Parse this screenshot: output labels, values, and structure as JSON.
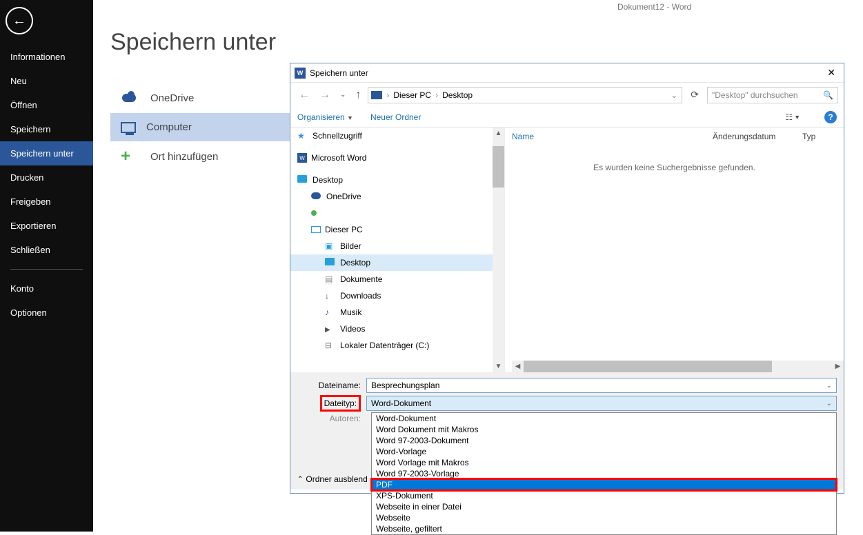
{
  "app_title": "Dokument12 - Word",
  "page_heading": "Speichern unter",
  "sidebar": {
    "items": [
      {
        "label": "Informationen"
      },
      {
        "label": "Neu"
      },
      {
        "label": "Öffnen"
      },
      {
        "label": "Speichern"
      },
      {
        "label": "Speichern unter",
        "selected": true
      },
      {
        "label": "Drucken"
      },
      {
        "label": "Freigeben"
      },
      {
        "label": "Exportieren"
      },
      {
        "label": "Schließen"
      }
    ],
    "account_label": "Konto",
    "options_label": "Optionen"
  },
  "locations": [
    {
      "label": "OneDrive",
      "icon": "cloud"
    },
    {
      "label": "Computer",
      "icon": "computer",
      "selected": true
    },
    {
      "label": "Ort hinzufügen",
      "icon": "plus"
    }
  ],
  "dialog": {
    "title": "Speichern unter",
    "breadcrumb": [
      "Dieser PC",
      "Desktop"
    ],
    "search_placeholder": "\"Desktop\" durchsuchen",
    "toolbar": {
      "organize": "Organisieren",
      "newfolder": "Neuer Ordner"
    },
    "tree": [
      {
        "label": "Schnellzugriff",
        "icon": "star",
        "lvl": 0
      },
      {
        "label": "Microsoft Word",
        "icon": "word",
        "lvl": 0
      },
      {
        "label": "Desktop",
        "icon": "folder-blue",
        "lvl": 0
      },
      {
        "label": "OneDrive",
        "icon": "cloud",
        "lvl": 1
      },
      {
        "label": "",
        "icon": "user",
        "lvl": 1
      },
      {
        "label": "Dieser PC",
        "icon": "pc",
        "lvl": 1
      },
      {
        "label": "Bilder",
        "icon": "folder-img",
        "lvl": 2
      },
      {
        "label": "Desktop",
        "icon": "folder-blue",
        "lvl": 2,
        "selected": true
      },
      {
        "label": "Dokumente",
        "icon": "folder-doc",
        "lvl": 2
      },
      {
        "label": "Downloads",
        "icon": "download",
        "lvl": 2
      },
      {
        "label": "Musik",
        "icon": "music",
        "lvl": 2
      },
      {
        "label": "Videos",
        "icon": "video",
        "lvl": 2
      },
      {
        "label": "Lokaler Datenträger (C:)",
        "icon": "disk",
        "lvl": 2
      }
    ],
    "columns": {
      "name": "Name",
      "date": "Änderungsdatum",
      "type": "Typ"
    },
    "no_results": "Es wurden keine Suchergebnisse gefunden.",
    "filename_label": "Dateiname:",
    "filename_value": "Besprechungsplan",
    "filetype_label": "Dateityp:",
    "filetype_value": "Word-Dokument",
    "authors_label": "Autoren:",
    "folder_hide": "Ordner ausblend",
    "filetype_options": [
      {
        "label": "Word-Dokument"
      },
      {
        "label": "Word Dokument mit Makros"
      },
      {
        "label": "Word 97-2003-Dokument"
      },
      {
        "label": "Word-Vorlage"
      },
      {
        "label": "Word Vorlage mit Makros"
      },
      {
        "label": "Word 97-2003-Vorlage"
      },
      {
        "label": "PDF",
        "selected": true
      },
      {
        "label": "XPS-Dokument"
      },
      {
        "label": "Webseite in einer Datei"
      },
      {
        "label": "Webseite"
      },
      {
        "label": "Webseite, gefiltert"
      }
    ]
  }
}
